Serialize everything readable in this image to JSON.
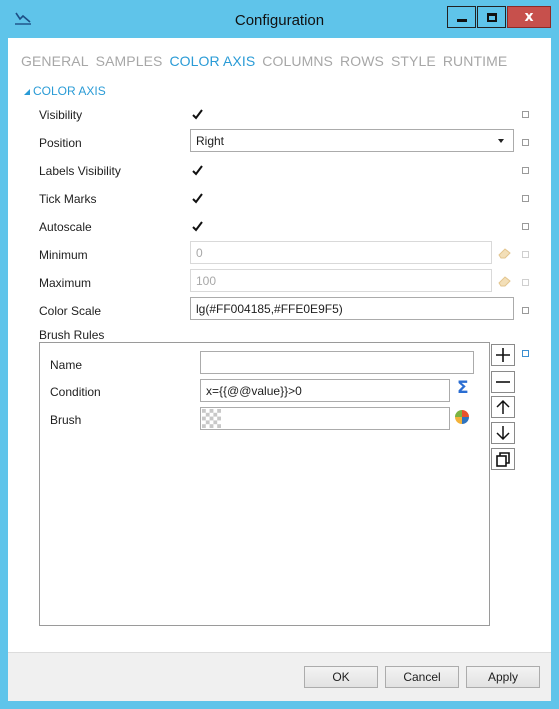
{
  "window": {
    "title": "Configuration",
    "close_glyph": "x"
  },
  "tabs": [
    {
      "label": "GENERAL"
    },
    {
      "label": "SAMPLES"
    },
    {
      "label": "COLOR AXIS"
    },
    {
      "label": "COLUMNS"
    },
    {
      "label": "ROWS"
    },
    {
      "label": "STYLE"
    },
    {
      "label": "RUNTIME"
    }
  ],
  "active_tab": "COLOR AXIS",
  "section": {
    "title": "COLOR AXIS"
  },
  "fields": {
    "visibility": {
      "label": "Visibility",
      "checked": true
    },
    "position": {
      "label": "Position",
      "value": "Right"
    },
    "labels_visibility": {
      "label": "Labels Visibility",
      "checked": true
    },
    "tick_marks": {
      "label": "Tick Marks",
      "checked": true
    },
    "autoscale": {
      "label": "Autoscale",
      "checked": true
    },
    "minimum": {
      "label": "Minimum",
      "value": "0"
    },
    "maximum": {
      "label": "Maximum",
      "value": "100"
    },
    "color_scale": {
      "label": "Color Scale",
      "value": "lg(#FF004185,#FFE0E9F5)"
    }
  },
  "brush_rules": {
    "label": "Brush Rules",
    "name_label": "Name",
    "name_value": "",
    "condition_label": "Condition",
    "condition_value": "x={{@@value}}>0",
    "brush_label": "Brush"
  },
  "side_buttons": [
    "+",
    "−",
    "↑",
    "↓",
    "copy"
  ],
  "footer": {
    "ok": "OK",
    "cancel": "Cancel",
    "apply": "Apply"
  },
  "colors": {
    "titlebar": "#5fc4ea",
    "accent": "#2a9bd6",
    "close_button": "#c7504c"
  },
  "icons": {
    "app": "app-logo-icon",
    "dropdown": "chevron-down-icon",
    "reset": "eraser-icon",
    "sigma": "sigma-icon",
    "palette": "color-palette-icon"
  }
}
